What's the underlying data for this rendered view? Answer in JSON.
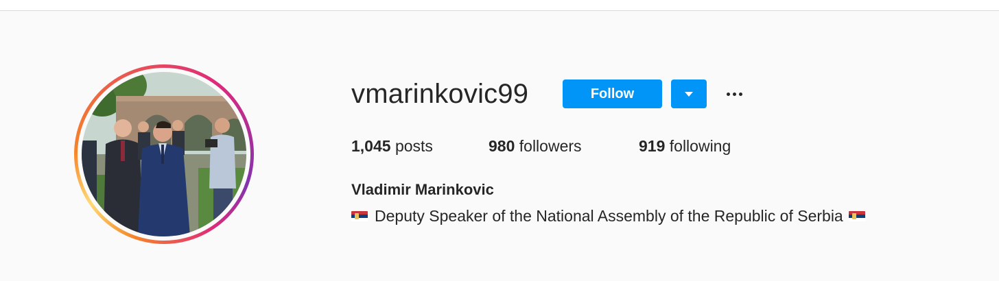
{
  "profile": {
    "username": "vmarinkovic99",
    "full_name": "Vladimir Marinkovic",
    "bio": {
      "flag_left": "serbian-flag",
      "text": "Deputy Speaker of the National Assembly of the Republic of Serbia",
      "flag_right": "serbian-flag"
    }
  },
  "actions": {
    "follow_label": "Follow",
    "dropdown_icon": "chevron-down-icon",
    "more_icon": "more-options-icon"
  },
  "stats": {
    "posts": {
      "count": "1,045",
      "label": "posts"
    },
    "followers": {
      "count": "980",
      "label": "followers"
    },
    "following": {
      "count": "919",
      "label": "following"
    }
  },
  "colors": {
    "primary_button": "#0095f6",
    "text": "#262626",
    "background": "#fafafa"
  }
}
